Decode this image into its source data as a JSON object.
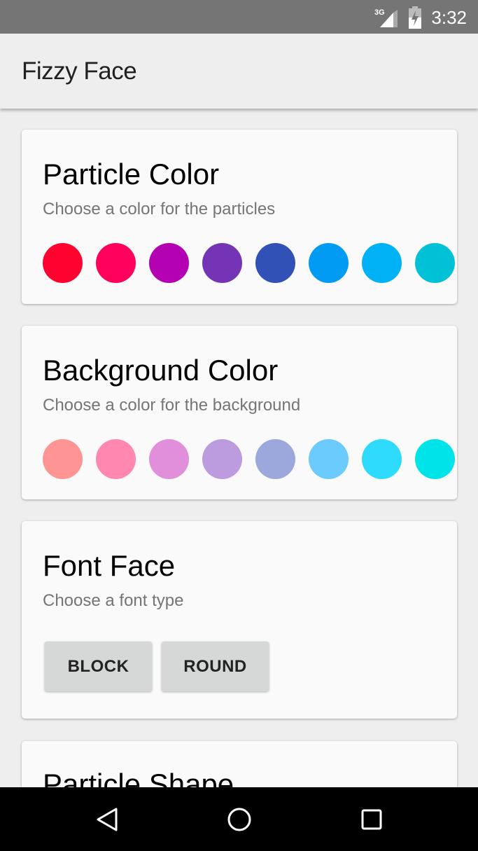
{
  "status": {
    "network": "3G",
    "time": "3:32"
  },
  "app": {
    "title": "Fizzy Face"
  },
  "sections": {
    "particle": {
      "title": "Particle Color",
      "subtitle": "Choose a color for the particles",
      "colors": [
        "#ff0330",
        "#ff015d",
        "#b402b2",
        "#7533b5",
        "#3151b7",
        "#029bf4",
        "#00b1f5",
        "#00c1d5"
      ]
    },
    "background": {
      "title": "Background Color",
      "subtitle": "Choose a color for the background",
      "colors": [
        "#ff9494",
        "#ff87b0",
        "#e18fda",
        "#bc9bde",
        "#9ca8dc",
        "#6bcbfc",
        "#2edbfd",
        "#00e4e9"
      ]
    },
    "font": {
      "title": "Font Face",
      "subtitle": "Choose a font type",
      "buttons": [
        "BLOCK",
        "ROUND"
      ]
    },
    "shape": {
      "title": "Particle Shape"
    }
  }
}
